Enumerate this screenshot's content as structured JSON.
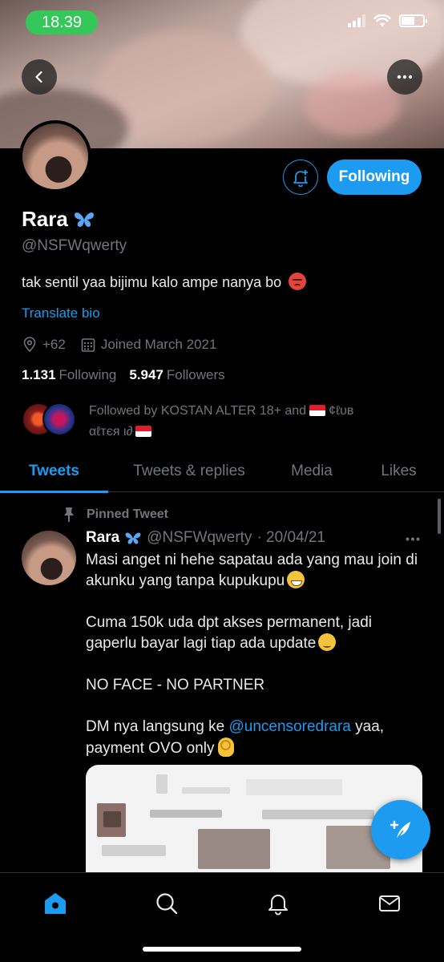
{
  "status_bar": {
    "time": "18.39"
  },
  "profile": {
    "name": "Rara",
    "handle": "@NSFWqwerty",
    "bio": "tak sentil yaa bijimu kalo ampe nanya bo",
    "translate_label": "Translate bio",
    "location": "+62",
    "joined": "Joined March 2021",
    "following_count": "1.131",
    "following_label": "Following",
    "followers_count": "5.947",
    "followers_label": "Followers",
    "followed_by_prefix": "Followed by KOSTAN ALTER 18+ and",
    "followed_by_second": "¢ℓυв",
    "followed_by_third": "αℓтєя ι∂",
    "follow_button_label": "Following"
  },
  "tabs": [
    {
      "label": "Tweets",
      "active": true
    },
    {
      "label": "Tweets & replies",
      "active": false
    },
    {
      "label": "Media",
      "active": false
    },
    {
      "label": "Likes",
      "active": false
    }
  ],
  "pinned_tweet": {
    "pinned_label": "Pinned Tweet",
    "author_name": "Rara",
    "author_handle": "@NSFWqwerty",
    "date": "· 20/04/21",
    "line1": "Masi anget ni hehe sapatau ada yang mau join di akunku yang tanpa kupukupu",
    "line2": "Cuma 150k uda dpt akses permanent, jadi gaperlu bayar lagi tiap ada update",
    "line3": "NO FACE - NO PARTNER",
    "line4_prefix": "DM nya langsung ke",
    "line4_mention": "@uncensoredrara",
    "line4_suffix": "yaa, payment OVO only"
  },
  "colors": {
    "accent": "#1d9bf0",
    "background": "#000000",
    "muted": "#71767b",
    "status_green": "#35c759"
  },
  "icons": [
    "back-arrow-icon",
    "more-horizontal-icon",
    "bell-plus-icon",
    "butterfly-icon",
    "location-pin-icon",
    "calendar-icon",
    "pin-icon",
    "compose-tweet-icon",
    "home-icon",
    "search-icon",
    "notifications-icon",
    "messages-icon",
    "wifi-icon",
    "battery-icon",
    "signal-icon"
  ]
}
